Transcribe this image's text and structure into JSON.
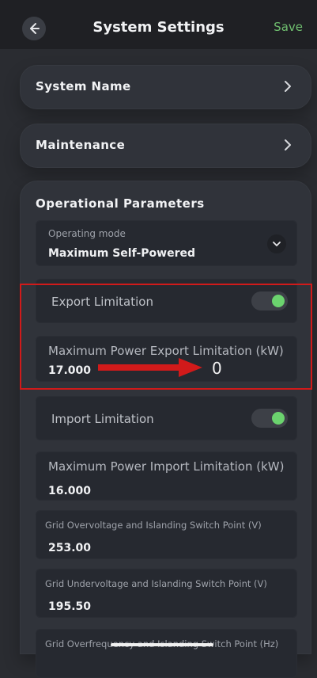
{
  "header": {
    "title": "System Settings",
    "save_label": "Save"
  },
  "rows": {
    "system_name": "System Name",
    "maintenance": "Maintenance"
  },
  "panel": {
    "title": "Operational Parameters",
    "operating_mode": {
      "label": "Operating mode",
      "value": "Maximum Self-Powered"
    },
    "export_limitation": {
      "label": "Export Limitation",
      "enabled": true
    },
    "max_export": {
      "label": "Maximum Power Export Limitation (kW)",
      "value": "17.000",
      "annotation_value": "0"
    },
    "import_limitation": {
      "label": "Import Limitation",
      "enabled": true
    },
    "max_import": {
      "label": "Maximum Power Import Limitation (kW)",
      "value": "16.000"
    },
    "grid_overvoltage": {
      "label": "Grid Overvoltage and Islanding Switch Point (V)",
      "value": "253.00"
    },
    "grid_undervoltage": {
      "label": "Grid Undervoltage and Islanding Switch Point (V)",
      "value": "195.50"
    },
    "grid_overfrequency": {
      "label": "Grid Overfrequency and Islanding Switch Point (Hz)"
    }
  },
  "colors": {
    "background": "#2a2c31",
    "card": "#30333a",
    "field": "#262930",
    "accent_green": "#6fbe6f",
    "toggle_on": "#6bd36e",
    "annotation_red": "#d11a1a"
  },
  "icons": {
    "back": "back-arrow-icon",
    "chevron": "chevron-right-icon",
    "dropdown": "chevron-down-icon"
  }
}
